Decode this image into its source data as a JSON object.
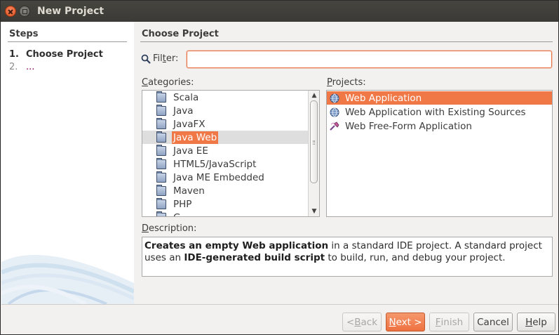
{
  "window": {
    "title": "New Project"
  },
  "steps": {
    "title": "Steps",
    "items": [
      {
        "num": "1.",
        "label": "Choose Project"
      },
      {
        "num": "2.",
        "label": "..."
      }
    ]
  },
  "main": {
    "title": "Choose Project",
    "filter": {
      "label_pre": "Fil",
      "label_mnemonic": "t",
      "label_post": "er:",
      "value": ""
    },
    "categories": {
      "label_mnemonic": "C",
      "label_rest": "ategories:",
      "items": [
        {
          "label": "Scala",
          "selected": false
        },
        {
          "label": "Java",
          "selected": false
        },
        {
          "label": "JavaFX",
          "selected": false
        },
        {
          "label": "Java Web",
          "selected": true
        },
        {
          "label": "Java EE",
          "selected": false
        },
        {
          "label": "HTML5/JavaScript",
          "selected": false
        },
        {
          "label": "Java ME Embedded",
          "selected": false
        },
        {
          "label": "Maven",
          "selected": false
        },
        {
          "label": "PHP",
          "selected": false
        },
        {
          "label": "G...",
          "selected": false
        }
      ]
    },
    "projects": {
      "label_mnemonic": "P",
      "label_rest": "rojects:",
      "items": [
        {
          "label": "Web Application",
          "icon": "globe-icon",
          "selected": true
        },
        {
          "label": "Web Application with Existing Sources",
          "icon": "globe-icon",
          "selected": false
        },
        {
          "label": "Web Free-Form Application",
          "icon": "hammer-icon",
          "selected": false
        }
      ]
    },
    "description": {
      "label_mnemonic": "D",
      "label_rest": "escription:",
      "parts": [
        {
          "text": "Creates an empty Web application",
          "bold": true
        },
        {
          "text": " in a standard IDE project. A standard project uses an ",
          "bold": false
        },
        {
          "text": "IDE-generated build script",
          "bold": true
        },
        {
          "text": " to build, run, and debug your project.",
          "bold": false
        }
      ]
    }
  },
  "buttons": {
    "back": {
      "pre": "< ",
      "mnemonic": "B",
      "post": "ack"
    },
    "next": {
      "pre": "",
      "mnemonic": "N",
      "post": "ext >"
    },
    "finish": {
      "pre": "",
      "mnemonic": "F",
      "post": "inish"
    },
    "cancel": {
      "label": "Cancel"
    },
    "help": {
      "pre": "",
      "mnemonic": "H",
      "post": "elp"
    }
  },
  "colors": {
    "accent": "#f07746",
    "titlebar": "#3c3b37",
    "background": "#f2f1f0"
  }
}
